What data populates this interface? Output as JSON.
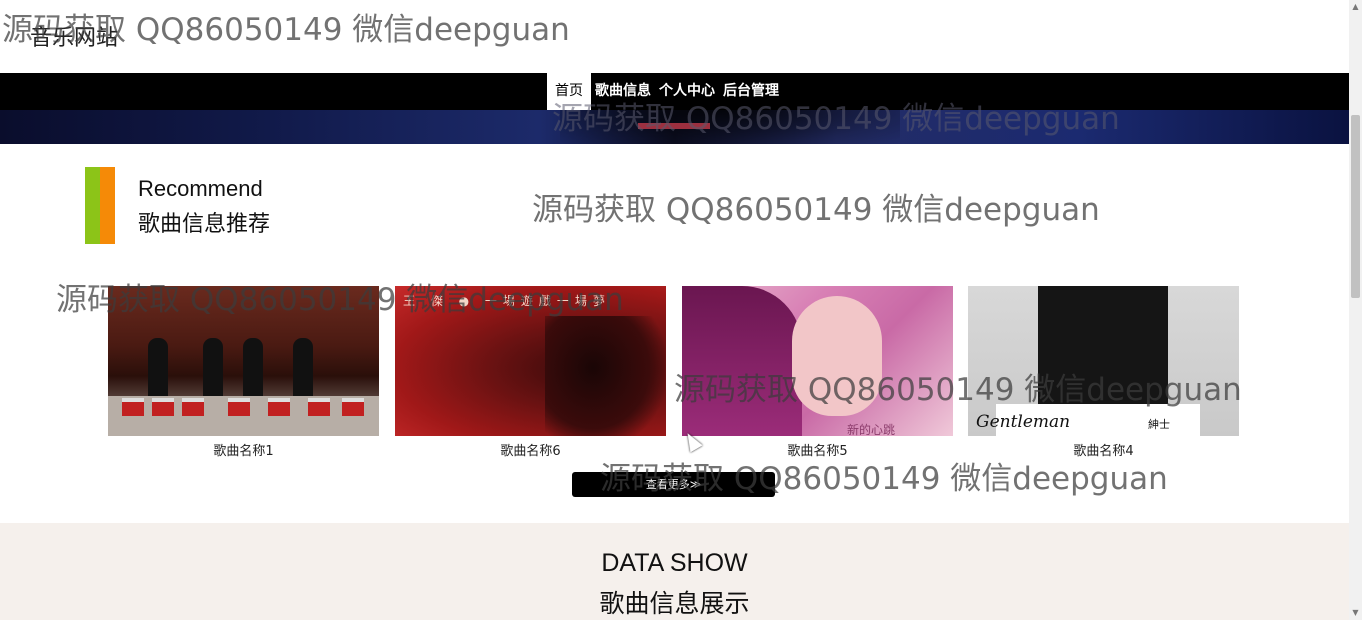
{
  "header": {
    "site_title": "音乐网站"
  },
  "nav": {
    "items": [
      {
        "label": "首页",
        "active": true
      },
      {
        "label": "歌曲信息",
        "active": false
      },
      {
        "label": "个人中心",
        "active": false
      },
      {
        "label": "后台管理",
        "active": false
      }
    ]
  },
  "recommend": {
    "title_en": "Recommend",
    "title_cn": "歌曲信息推荐",
    "accent_colors": [
      "#8cc418",
      "#f58a07"
    ],
    "cards": [
      {
        "name": "歌曲名称1",
        "image": "drummers-performing-image"
      },
      {
        "name": "歌曲名称6",
        "image": "red-face-album-image",
        "image_text": "王 傑 ● 一場遊戲一場夢"
      },
      {
        "name": "歌曲名称5",
        "image": "pink-portrait-album-image",
        "image_text": "新的心跳"
      },
      {
        "name": "歌曲名称4",
        "image": "gentleman-album-image",
        "image_text": "Gentleman",
        "image_text_2": "紳士"
      }
    ],
    "more_button": "查看更多≫"
  },
  "data_show": {
    "title_en": "DATA SHOW",
    "title_cn": "歌曲信息展示"
  },
  "watermark": {
    "text": "源码获取 QQ86050149 微信deepguan"
  }
}
